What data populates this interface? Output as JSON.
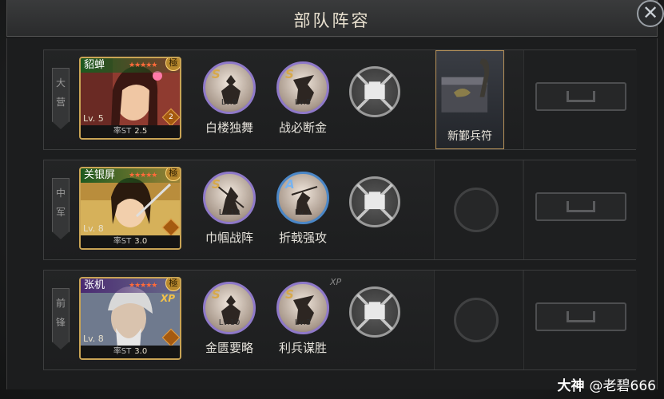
{
  "title": "部队阵容",
  "close_label": "✕",
  "rows": [
    {
      "tag": "大营",
      "hero": {
        "name": "貂蝉",
        "stars": "★★★★★",
        "grade": "極",
        "level": "Lv. 5",
        "troop_count": "2",
        "foot_label": "率ST",
        "foot_value": "2.5",
        "colors": {
          "bg": "#b0463a",
          "accent": "#e9b68b"
        }
      },
      "skills": [
        {
          "grade": "S",
          "level": "Lv.9",
          "name": "白楼独舞",
          "ring": "s"
        },
        {
          "grade": "S",
          "level": "Lv.5",
          "name": "战必断金",
          "ring": "s"
        }
      ],
      "item": {
        "name": "新鄞兵符"
      },
      "xp": ""
    },
    {
      "tag": "中军",
      "hero": {
        "name": "关银屏",
        "stars": "★★★★★",
        "grade": "極",
        "level": "Lv. 8",
        "troop_count": "",
        "foot_label": "率ST",
        "foot_value": "3.0",
        "colors": {
          "bg": "#c4a246",
          "accent": "#f3d58a"
        }
      },
      "skills": [
        {
          "grade": "S",
          "level": "Lv.10",
          "name": "巾帼战阵",
          "ring": "s"
        },
        {
          "grade": "A",
          "level": "Lv.1",
          "name": "折戟强攻",
          "ring": "a"
        }
      ],
      "item": null,
      "xp": ""
    },
    {
      "tag": "前锋",
      "hero": {
        "name": "张机",
        "stars": "★★★★★",
        "grade": "極",
        "level": "Lv. 8",
        "troop_count": "",
        "foot_label": "率ST",
        "foot_value": "3.0",
        "xp_badge": "XP",
        "colors": {
          "bg": "#7e8aa2",
          "accent": "#d8dbe2"
        }
      },
      "skills": [
        {
          "grade": "S",
          "level": "Lv.10",
          "name": "金匮要略",
          "ring": "s"
        },
        {
          "grade": "S",
          "level": "Lv.3",
          "name": "利兵谋胜",
          "ring": "s"
        }
      ],
      "item": null,
      "xp": "XP"
    }
  ],
  "watermark": {
    "brand": "大神",
    "handle": "@老碧666"
  }
}
